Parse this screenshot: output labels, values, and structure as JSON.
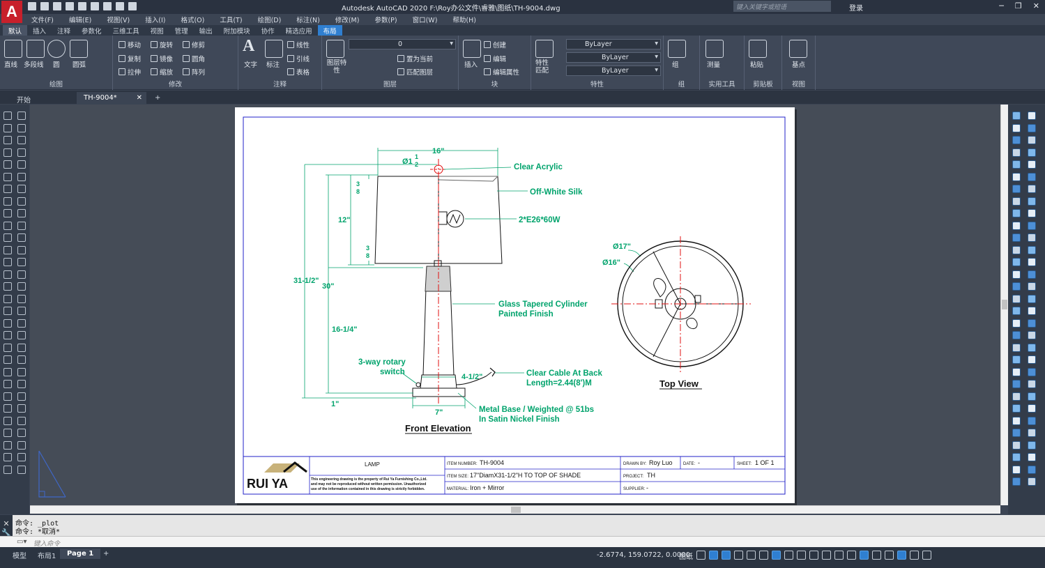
{
  "titlebar": {
    "logo": "A",
    "title": "Autodesk AutoCAD 2020    F:\\Roy办公文件\\睿雅\\图纸\\TH-9004.dwg",
    "search_placeholder": "键入关键字或短语",
    "login": "登录"
  },
  "menu": [
    "文件(F)",
    "编辑(E)",
    "视图(V)",
    "插入(I)",
    "格式(O)",
    "工具(T)",
    "绘图(D)",
    "标注(N)",
    "修改(M)",
    "参数(P)",
    "窗口(W)",
    "帮助(H)"
  ],
  "ribbon_tabs": [
    "默认",
    "插入",
    "注释",
    "参数化",
    "三维工具",
    "视图",
    "管理",
    "输出",
    "附加模块",
    "协作",
    "精选应用",
    "布局"
  ],
  "ribbon": {
    "draw": {
      "title": "绘图",
      "line": "直线",
      "polyline": "多段线",
      "circle": "圆",
      "arc": "圆弧"
    },
    "modify": {
      "title": "修改",
      "move": "移动",
      "rotate": "旋转",
      "trim": "修剪",
      "copy": "复制",
      "mirror": "镜像",
      "fillet": "圆角",
      "stretch": "拉伸",
      "scale": "缩放",
      "array": "阵列"
    },
    "annotation": {
      "title": "注释",
      "text": "文字",
      "dimension": "标注",
      "linear": "线性",
      "leader": "引线",
      "table": "表格"
    },
    "layers": {
      "title": "图层",
      "layer_props": "图层特性",
      "current_layer": "0",
      "make_current": "置为当前",
      "match_layer": "匹配图层"
    },
    "block": {
      "title": "块",
      "insert": "插入",
      "create": "创建",
      "edit": "编辑",
      "edit_attr": "编辑属性"
    },
    "properties": {
      "title": "特性",
      "match": "特性匹配",
      "color": "ByLayer",
      "linetype": "ByLayer",
      "lineweight": "ByLayer"
    },
    "groups": {
      "title": "组",
      "group": "组"
    },
    "utilities": {
      "title": "实用工具",
      "measure": "测量"
    },
    "clipboard": {
      "title": "剪贴板",
      "paste": "粘贴"
    },
    "view": {
      "title": "视图",
      "base": "基点"
    }
  },
  "doc_tabs": {
    "start": "开始",
    "file": "TH-9004*"
  },
  "drawing": {
    "dims": {
      "top_width": "16\"",
      "finial": "Ø1",
      "finial_num": "1",
      "finial_den": "2",
      "shade_top_off_num": "3",
      "shade_top_off_den": "8",
      "shade_h": "12\"",
      "shade_bot_off_num": "3",
      "shade_bot_off_den": "8",
      "overall": "31-1/2\"",
      "to_shade": "30\"",
      "body": "16-1/4\"",
      "base_h": "1\"",
      "base_w": "7\"",
      "mid_w": "4-1/2\"",
      "top_d17": "Ø17\"",
      "top_d16": "Ø16\""
    },
    "callouts": {
      "acrylic": "Clear Acrylic",
      "silk": "Off-White Silk",
      "bulb": "2*E26*60W",
      "glass1": "Glass Tapered Cylinder",
      "glass2": "Painted Finish",
      "switch1": "3-way rotary",
      "switch2": "switch",
      "cable1": "Clear Cable At Back",
      "cable2": "Length=2.44(8')M",
      "base1": "Metal Base / Weighted @ 51bs",
      "base2": "In Satin Nickel Finish"
    },
    "front_title": "Front Elevation",
    "top_title": "Top View"
  },
  "titleblock": {
    "logo": "RUI YA",
    "item_label": "LAMP",
    "disclaimer1": "This engineering drawing is the property of Rui Ya Furnishing Co.,Ltd.",
    "disclaimer2": "and may not be reproduced without written permission. Unauthorized",
    "disclaimer3": "use of the information contained in this drawing is strictly forbidden.",
    "item_number_label": "ITEM NUMBER:",
    "item_number": "TH-9004",
    "item_size_label": "ITEM SIZE:",
    "item_size": "17\"DiamX31-1/2\"H TO TOP OF SHADE",
    "material_label": "MATERIAL:",
    "material": "Iron + Mirror",
    "drawn_by_label": "DRAWN BY:",
    "drawn_by": "Roy Luo",
    "date_label": "DATE:",
    "date": "-",
    "sheet_label": "SHEET:",
    "sheet": "1 OF 1",
    "project_label": "PROJECT:",
    "project": "TH",
    "supplier_label": "SUPPLIER:",
    "supplier": "-"
  },
  "command": {
    "history1": "命令: _plot",
    "history2": "命令: *取消*",
    "placeholder": "键入命令"
  },
  "layout_tabs": [
    "模型",
    "布局1",
    "Page 1"
  ],
  "status": {
    "coords": "-2.6774, 159.0722, 0.0000",
    "paper": "图纸"
  },
  "colors": {
    "drawing_green": "#00a36c",
    "drawing_blue": "#2020c8",
    "drawing_red": "#e01010",
    "accent": "#2f7fd1"
  }
}
